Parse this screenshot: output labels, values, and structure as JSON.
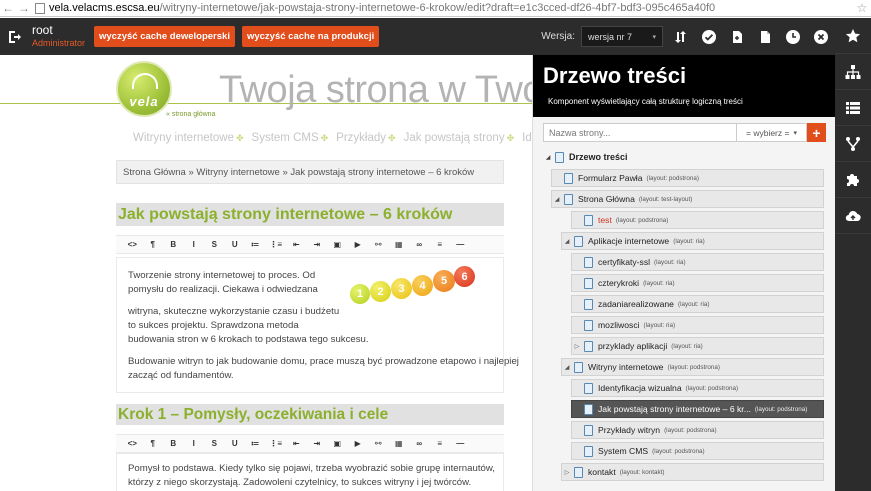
{
  "browser": {
    "url_host": "vela.velacms.escsa.eu",
    "url_path": "/witryny-internetowe/jak-powstaja-strony-internetowe-6-krokow/edit?draft=e1c3cced-df26-4bf7-bdf3-095c465a40f0"
  },
  "toolbar": {
    "user_name": "root",
    "user_role": "Administrator",
    "btn_cache_dev": "wyczyść cache deweloperski",
    "btn_cache_prod": "wyczyść cache na produkcji",
    "version_label": "Wersja:",
    "version_value": "wersja nr 7"
  },
  "site": {
    "logo_text": "vela",
    "home_link": "strona główna",
    "title": "Twoja strona w Two",
    "nav": [
      "Witryny internetowe",
      "System CMS",
      "Przykłady",
      "Jak powstają strony",
      "Identy"
    ],
    "breadcrumb": "Strona Główna » Witryny internetowe » Jak powstają strony internetowe – 6 kroków",
    "heading1": "Jak powstają strony internetowe – 6 kroków",
    "para1_l1": "Tworzenie strony internetowej to proces. Od",
    "para1_l2": "pomysłu do realizacji. Ciekawa i odwiedzana",
    "para2_l1": "witryna, skuteczne wykorzystanie czasu i budżetu",
    "para2_l2": "to sukces projektu. Sprawdzona metoda",
    "para2_l3": "budowania stron w 6 krokach to podstawa tego sukcesu.",
    "para3_l1": "Budowanie witryn to jak budowanie domu, prace muszą być prowadzone etapowo i najlepiej",
    "para3_l2": "zacząć od fundamentów.",
    "numbers": [
      "1",
      "2",
      "3",
      "4",
      "5",
      "6"
    ],
    "heading2": "Krok 1 – Pomysły, oczekiwania i cele",
    "para4_l1": "Pomysł to podstawa. Kiedy tylko się pojawi, trzeba wyobrazić sobie grupę internautów,",
    "para4_l2": "którzy z niego skorzystają. Zadowoleni czytelnicy, to sukces witryny i jej twórców."
  },
  "editor_tools": [
    "<>",
    "¶",
    "B",
    "I",
    "S",
    "U",
    "≔",
    "⋮≡",
    "⇤",
    "⇥",
    "▣",
    "▶",
    "⚯",
    "▦",
    "∞",
    "≡",
    "—"
  ],
  "tree_panel": {
    "title": "Drzewo treści",
    "subtitle": "Komponent wyświetlający całą strukturę logiczną treści",
    "search_placeholder": "Nazwa strony...",
    "select_label": "= wybierz =",
    "add_label": "+",
    "root_label": "Drzewo treści",
    "nodes": [
      {
        "label": "Formularz Pawła",
        "layout": "(layout: podstrona)"
      },
      {
        "label": "Strona Główna",
        "layout": "(layout: test-layout)"
      },
      {
        "label": "test",
        "layout": "(layout: podstrona)"
      },
      {
        "label": "Aplikacje internetowe",
        "layout": "(layout: ria)"
      },
      {
        "label": "certyfikaty-ssl",
        "layout": "(layout: ria)"
      },
      {
        "label": "czterykroki",
        "layout": "(layout: ria)"
      },
      {
        "label": "zadaniarealizowane",
        "layout": "(layout: ria)"
      },
      {
        "label": "mozliwosci",
        "layout": "(layout: ria)"
      },
      {
        "label": "przyklady aplikacji",
        "layout": "(layout: ria)"
      },
      {
        "label": "Witryny internetowe",
        "layout": "(layout: podstrona)"
      },
      {
        "label": "Identyfikacja wizualna",
        "layout": "(layout: podstrona)"
      },
      {
        "label": "Jak powstają strony internetowe – 6 kr...",
        "layout": "(layout: podstrona)"
      },
      {
        "label": "Przykłady witryn",
        "layout": "(layout: podstrona)"
      },
      {
        "label": "System CMS",
        "layout": "(layout: podstrona)"
      },
      {
        "label": "kontakt",
        "layout": "(layout: kontakt)"
      }
    ]
  },
  "colors": {
    "accent_orange": "#e24d1c",
    "toolbar_bg": "#2c2c2c",
    "heading_green": "#8cb02e",
    "active_node": "#555555"
  }
}
